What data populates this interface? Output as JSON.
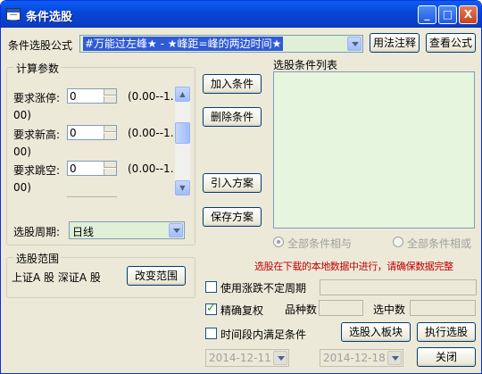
{
  "window": {
    "title": "条件选股",
    "icon": "app-window-icon",
    "min_glyph": "_",
    "max_glyph": "□",
    "close_glyph": "X"
  },
  "formula": {
    "label": "条件选股公式",
    "selected": "#万能过左峰★ - ★峰距=峰的两边时间★",
    "usage_button": "用法注释",
    "view_button": "查看公式"
  },
  "params": {
    "group_label": "计算参数",
    "rows": [
      {
        "label": "要求涨停:",
        "value": "0",
        "range_a": "(0.00--1.",
        "range_b": "00)"
      },
      {
        "label": "要求新高:",
        "value": "0",
        "range_a": "(0.00--1.",
        "range_b": "00)"
      },
      {
        "label": "要求跳空:",
        "value": "0",
        "range_a": "(0.00--1.",
        "range_b": "00)"
      }
    ],
    "period_label": "选股周期:",
    "period_value": "日线"
  },
  "actions": {
    "add": "加入条件",
    "delete": "删除条件",
    "import": "引入方案",
    "save": "保存方案"
  },
  "conditions": {
    "list_label": "选股条件列表",
    "radio_all_and": "全部条件相与",
    "radio_all_or": "全部条件相或",
    "notice": "选股在下载的本地数据中进行，请确保数据完整"
  },
  "range": {
    "group_label": "选股范围",
    "text": "上证A 股  深证A 股",
    "change_button": "改变范围"
  },
  "options": {
    "unfixed_period": "使用涨跌不定周期",
    "precise_adjust": "精确复权",
    "period_satisfy": "时间段内满足条件",
    "varieties_label": "品种数",
    "selected_label": "选中数",
    "date_from": "2014-12-11",
    "date_to": "2014-12-18"
  },
  "bottom": {
    "to_block": "选股入板块",
    "execute": "执行选股",
    "close": "关闭"
  },
  "colors": {
    "notice": "#c00000",
    "list_bg": "#e6f5dd",
    "combo_bg": "#dff0d6"
  }
}
